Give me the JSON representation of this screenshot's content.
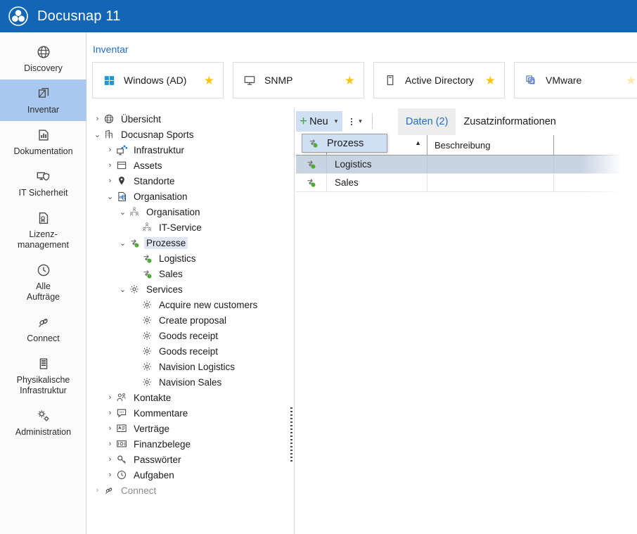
{
  "titlebar": {
    "app_title": "Docusnap 11",
    "logo_icon": "docusnap-logo-icon",
    "bg": "#1266b5"
  },
  "rail": {
    "items": [
      {
        "label": "Discovery",
        "icon": "globe-icon",
        "active": false
      },
      {
        "label": "Inventar",
        "icon": "inventory-icon",
        "active": true
      },
      {
        "label": "Dokumentation",
        "icon": "chart-document-icon",
        "active": false
      },
      {
        "label": "IT Sicherheit",
        "icon": "shield-monitor-icon",
        "active": false
      },
      {
        "label": "Lizenz-\nmanagement",
        "icon": "license-document-icon",
        "active": false
      },
      {
        "label": "Alle\nAufträge",
        "icon": "clock-icon",
        "active": false
      },
      {
        "label": "Connect",
        "icon": "connector-icon",
        "active": false
      },
      {
        "label": "Physikalische\nInfrastruktur",
        "icon": "server-rack-icon",
        "active": false
      },
      {
        "label": "Administration",
        "icon": "gears-icon",
        "active": false
      }
    ]
  },
  "breadcrumb": "Inventar",
  "source_tabs": [
    {
      "label": "Windows (AD)",
      "icon": "windows-icon",
      "starred": true,
      "star_faded": false
    },
    {
      "label": "SNMP",
      "icon": "monitor-icon",
      "starred": true,
      "star_faded": false
    },
    {
      "label": "Active Directory",
      "icon": "ad-server-icon",
      "starred": true,
      "star_faded": false
    },
    {
      "label": "VMware",
      "icon": "vmware-icon",
      "starred": true,
      "star_faded": true
    }
  ],
  "tree": [
    {
      "label": "Übersicht",
      "icon": "globe-icon",
      "depth": 0,
      "twist": "collapsed",
      "selected": false,
      "dim": false
    },
    {
      "label": "Docusnap Sports",
      "icon": "company-icon",
      "depth": 0,
      "twist": "expanded",
      "selected": false,
      "dim": false
    },
    {
      "label": "Infrastruktur",
      "icon": "network-icon",
      "depth": 1,
      "twist": "collapsed",
      "selected": false,
      "dim": false
    },
    {
      "label": "Assets",
      "icon": "box-icon",
      "depth": 1,
      "twist": "collapsed",
      "selected": false,
      "dim": false
    },
    {
      "label": "Standorte",
      "icon": "pin-icon",
      "depth": 1,
      "twist": "collapsed",
      "selected": false,
      "dim": false
    },
    {
      "label": "Organisation",
      "icon": "org-document-icon",
      "depth": 1,
      "twist": "expanded",
      "selected": false,
      "dim": false
    },
    {
      "label": "Organisation",
      "icon": "org-chart-icon",
      "depth": 2,
      "twist": "expanded",
      "selected": false,
      "dim": false
    },
    {
      "label": "IT-Service",
      "icon": "org-chart-icon",
      "depth": 3,
      "twist": "none",
      "selected": false,
      "dim": false
    },
    {
      "label": "Prozesse",
      "icon": "process-icon",
      "depth": 2,
      "twist": "expanded",
      "selected": true,
      "dim": false
    },
    {
      "label": "Logistics",
      "icon": "process-icon",
      "depth": 3,
      "twist": "none",
      "selected": false,
      "dim": false
    },
    {
      "label": "Sales",
      "icon": "process-icon",
      "depth": 3,
      "twist": "none",
      "selected": false,
      "dim": false
    },
    {
      "label": "Services",
      "icon": "gear-icon",
      "depth": 2,
      "twist": "expanded",
      "selected": false,
      "dim": false
    },
    {
      "label": "Acquire new customers",
      "icon": "gear-icon",
      "depth": 3,
      "twist": "none",
      "selected": false,
      "dim": false
    },
    {
      "label": "Create proposal",
      "icon": "gear-icon",
      "depth": 3,
      "twist": "none",
      "selected": false,
      "dim": false
    },
    {
      "label": "Goods receipt",
      "icon": "gear-icon",
      "depth": 3,
      "twist": "none",
      "selected": false,
      "dim": false
    },
    {
      "label": "Goods receipt",
      "icon": "gear-icon",
      "depth": 3,
      "twist": "none",
      "selected": false,
      "dim": false
    },
    {
      "label": "Navision Logistics",
      "icon": "gear-icon",
      "depth": 3,
      "twist": "none",
      "selected": false,
      "dim": false
    },
    {
      "label": "Navision Sales",
      "icon": "gear-icon",
      "depth": 3,
      "twist": "none",
      "selected": false,
      "dim": false
    },
    {
      "label": "Kontakte",
      "icon": "contacts-icon",
      "depth": 1,
      "twist": "collapsed",
      "selected": false,
      "dim": false
    },
    {
      "label": "Kommentare",
      "icon": "comment-icon",
      "depth": 1,
      "twist": "collapsed",
      "selected": false,
      "dim": false
    },
    {
      "label": "Verträge",
      "icon": "contract-icon",
      "depth": 1,
      "twist": "collapsed",
      "selected": false,
      "dim": false
    },
    {
      "label": "Finanzbelege",
      "icon": "money-icon",
      "depth": 1,
      "twist": "collapsed",
      "selected": false,
      "dim": false
    },
    {
      "label": "Passwörter",
      "icon": "key-icon",
      "depth": 1,
      "twist": "collapsed",
      "selected": false,
      "dim": false
    },
    {
      "label": "Aufgaben",
      "icon": "clock-icon",
      "depth": 1,
      "twist": "collapsed",
      "selected": false,
      "dim": false
    },
    {
      "label": "Connect",
      "icon": "connector-icon",
      "depth": 0,
      "twist": "collapsed",
      "selected": false,
      "dim": true
    }
  ],
  "toolbar": {
    "new_label": "Neu",
    "new_plus": "+",
    "new_caret": "▾",
    "overflow_caret": "▾",
    "overflow_icon": "more-vertical-icon"
  },
  "dropdown": {
    "open": true,
    "item_label": "Prozess",
    "item_icon": "process-icon"
  },
  "data_tabs": [
    {
      "label": "Daten (2)",
      "active": true
    },
    {
      "label": "Zusatzinformationen",
      "active": false
    }
  ],
  "grid": {
    "columns": [
      "",
      "",
      "Beschreibung",
      ""
    ],
    "sort_indicator": "▲",
    "rows": [
      {
        "icon": "process-icon",
        "name": "Logistics",
        "beschreibung": "",
        "extra": "",
        "selected": true
      },
      {
        "icon": "process-icon",
        "name": "Sales",
        "beschreibung": "",
        "extra": "",
        "selected": false
      }
    ]
  },
  "colors": {
    "brand_blue": "#1266b5",
    "rail_active": "#a8c8f0",
    "row_selected": "#c9d4e3",
    "tree_selected": "#dfe7f2",
    "accent_link": "#1f6fc4",
    "star_gold": "#f5c518",
    "process_green": "#4caf30"
  }
}
